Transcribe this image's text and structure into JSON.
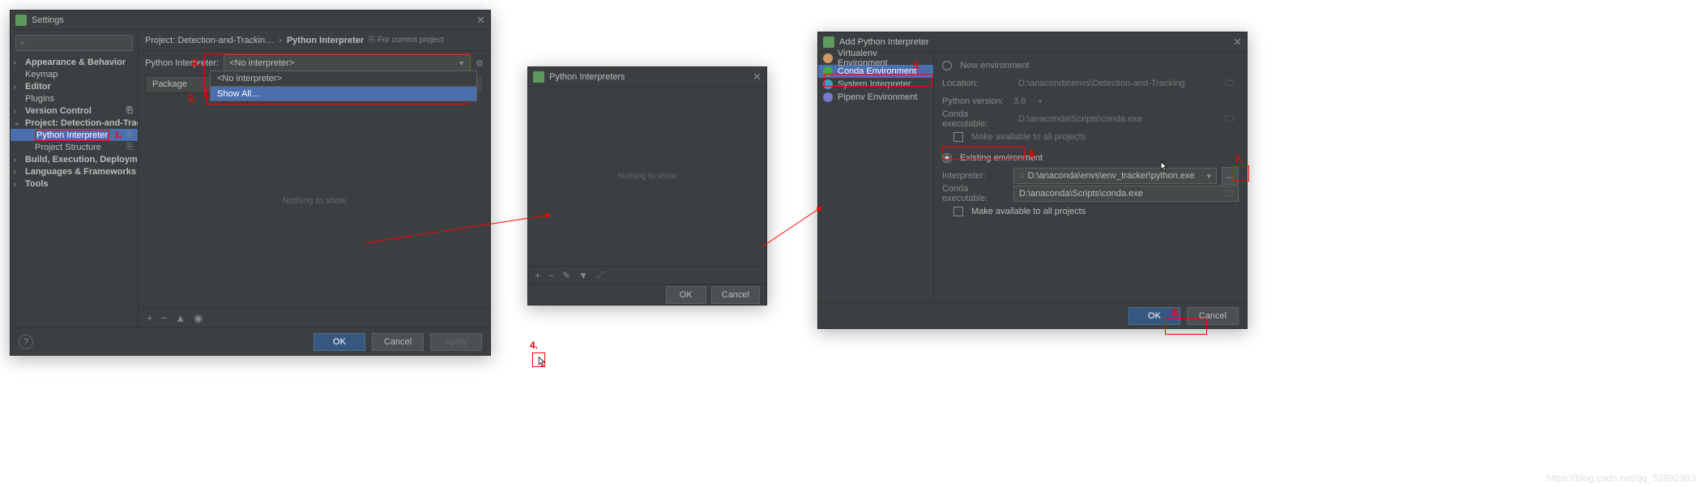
{
  "watermark": "https://blog.csdn.net/qq_32892383",
  "settings": {
    "title": "Settings",
    "search_placeholder": "Q",
    "tree": {
      "appearance": "Appearance & Behavior",
      "keymap": "Keymap",
      "editor": "Editor",
      "plugins": "Plugins",
      "version_control": "Version Control",
      "project": "Project: Detection-and-Trackin…",
      "python_interpreter": "Python Interpreter",
      "project_structure": "Project Structure",
      "build": "Build, Execution, Deployment",
      "languages": "Languages & Frameworks",
      "tools": "Tools"
    },
    "breadcrumb": {
      "project": "Project: Detection-and-Trackin…",
      "interpreter": "Python Interpreter",
      "for_project": "For current project"
    },
    "interpreter_label": "Python Interpreter:",
    "combo_value": "<No interpreter>",
    "dropdown": {
      "no_interp": "<No interpreter>",
      "show_all": "Show All…"
    },
    "package_header": "Package",
    "nothing": "Nothing to show",
    "buttons": {
      "ok": "OK",
      "cancel": "Cancel",
      "apply": "Apply"
    }
  },
  "steps": {
    "s1": "1.",
    "s2": "2.",
    "s3": "3.",
    "s4": "4.",
    "s5": "5.",
    "s6": "6.",
    "s7": "7.",
    "s8": "8."
  },
  "pyinterp": {
    "title": "Python Interpreters",
    "nothing": "Nothing to show",
    "ok": "OK",
    "cancel": "Cancel"
  },
  "addinterp": {
    "title": "Add Python Interpreter",
    "envs": {
      "virtualenv": "Virtualenv Environment",
      "conda": "Conda Environment",
      "system": "System Interpreter",
      "pipenv": "Pipenv Environment"
    },
    "new_env": "New environment",
    "location_lbl": "Location:",
    "location_val": "D:\\anaconda\\envs\\Detection-and-Tracking",
    "pyver_lbl": "Python version:",
    "pyver_val": "3.8",
    "condaexe_lbl": "Conda executable:",
    "condaexe_val": "D:\\anaconda\\Scripts\\conda.exe",
    "make_avail": "Make available to all projects",
    "existing": "Existing environment",
    "interp_lbl": "Interpreter:",
    "interp_val": "D:\\anaconda\\envs\\env_tracker\\python.exe",
    "condaexe2_val": "D:\\anaconda\\Scripts\\conda.exe",
    "ok": "OK",
    "cancel": "Cancel"
  }
}
